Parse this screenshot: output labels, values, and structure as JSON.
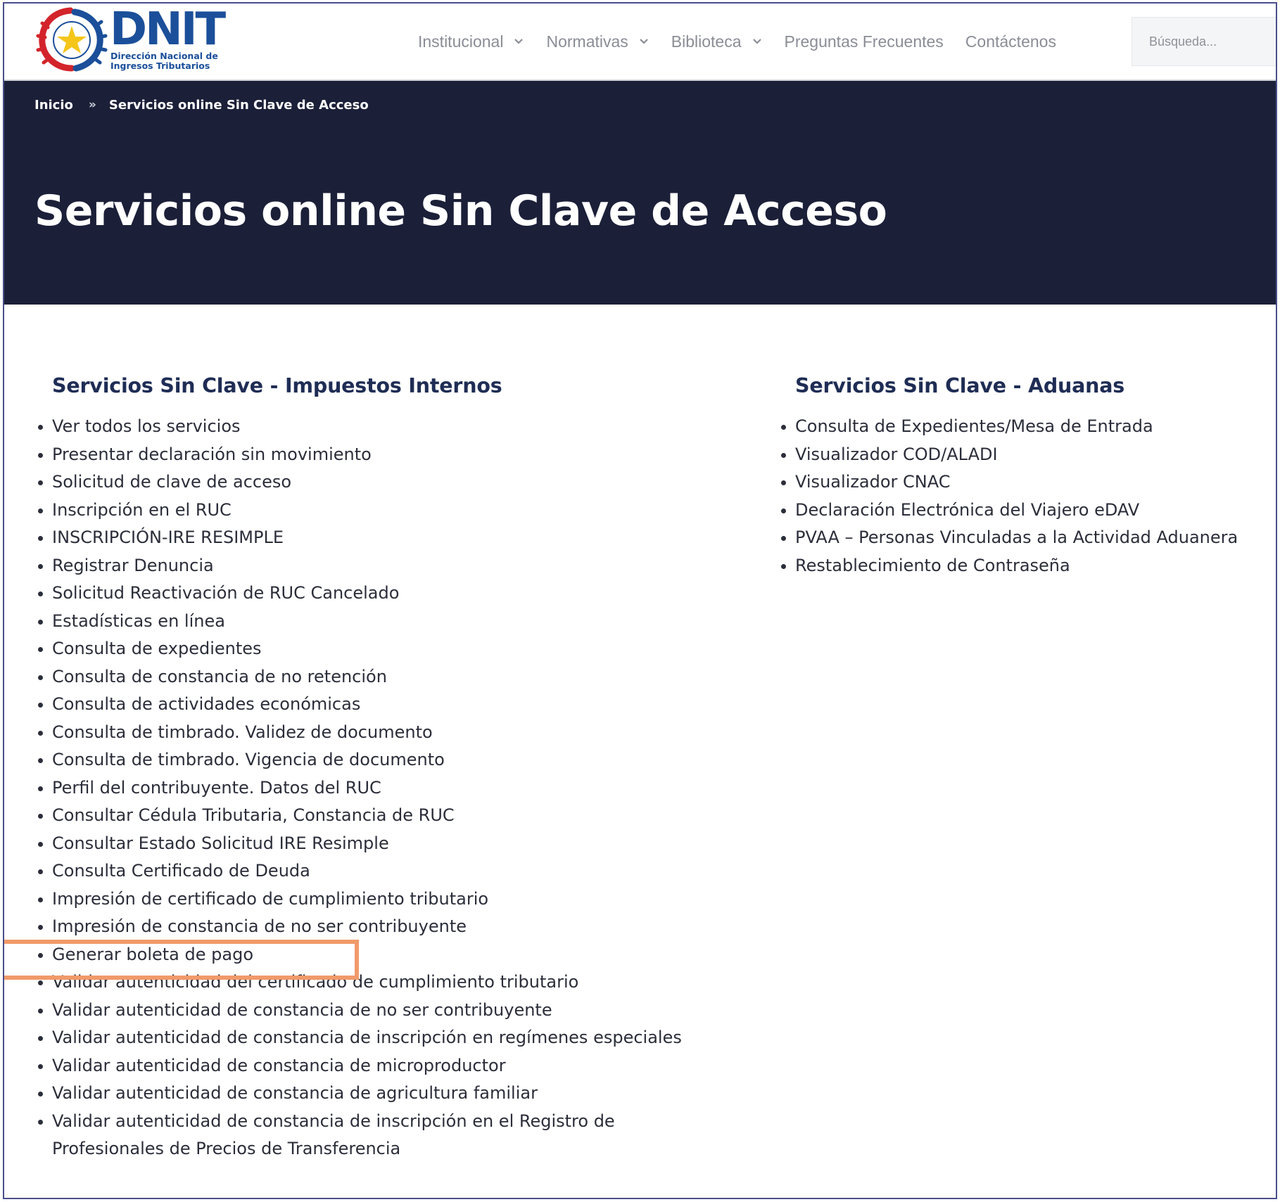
{
  "brand": {
    "logo_word": "DNIT",
    "logo_subtitle_line1": "Dirección Nacional de",
    "logo_subtitle_line2": "Ingresos Tributarios",
    "primary_color": "#1b4f9a",
    "seal_colors": [
      "#d3242b",
      "#1b4f9a",
      "#f5c518"
    ]
  },
  "nav": {
    "items": [
      {
        "label": "Institucional",
        "has_dropdown": true
      },
      {
        "label": "Normativas",
        "has_dropdown": true
      },
      {
        "label": "Biblioteca",
        "has_dropdown": true
      },
      {
        "label": "Preguntas Frecuentes",
        "has_dropdown": false
      },
      {
        "label": "Contáctenos",
        "has_dropdown": false
      }
    ],
    "search_placeholder": "Búsqueda..."
  },
  "breadcrumb": {
    "home": "Inicio",
    "separator": "»",
    "current": "Servicios online Sin Clave de Acceso"
  },
  "page_title": "Servicios online Sin Clave de Acceso",
  "sections": {
    "internos": {
      "title": "Servicios Sin Clave - Impuestos Internos",
      "items": [
        "Ver todos los servicios",
        "Presentar declaración sin movimiento",
        "Solicitud de clave de acceso",
        "Inscripción en el RUC",
        "INSCRIPCIÓN-IRE RESIMPLE",
        "Registrar Denuncia",
        "Solicitud Reactivación de RUC Cancelado",
        "Estadísticas en línea",
        "Consulta de expedientes",
        "Consulta de constancia de no retención",
        "Consulta de actividades económicas",
        "Consulta de timbrado. Validez de documento",
        "Consulta de timbrado. Vigencia de documento",
        "Perfil del contribuyente. Datos del RUC",
        "Consultar Cédula Tributaria, Constancia de RUC",
        "Consultar Estado Solicitud IRE Resimple",
        "Consulta Certificado de Deuda",
        "Impresión de certificado de cumplimiento tributario",
        "Impresión de constancia de no ser contribuyente",
        "Generar boleta de pago",
        "Validar autenticidad del certificado de cumplimiento tributario",
        "Validar autenticidad de constancia de no ser contribuyente",
        "Validar autenticidad de constancia de inscripción en regímenes especiales",
        "Validar autenticidad de constancia de microproductor",
        "Validar autenticidad de constancia de agricultura familiar",
        "Validar autenticidad de constancia de inscripción en el Registro de Profesionales de Precios de Transferencia"
      ]
    },
    "aduanas": {
      "title": "Servicios Sin Clave - Aduanas",
      "items": [
        "Consulta de Expedientes/Mesa de Entrada",
        "Visualizador COD/ALADI",
        "Visualizador CNAC",
        "Declaración Electrónica del Viajero eDAV",
        "PVAA – Personas Vinculadas a la Actividad Aduanera",
        "Restablecimiento de Contraseña"
      ]
    }
  },
  "highlighted_item": "Generar boleta de pago",
  "colors": {
    "header_band": "#1b1f38",
    "section_title": "#1f2d55",
    "highlight_box": "#f09a6a"
  }
}
